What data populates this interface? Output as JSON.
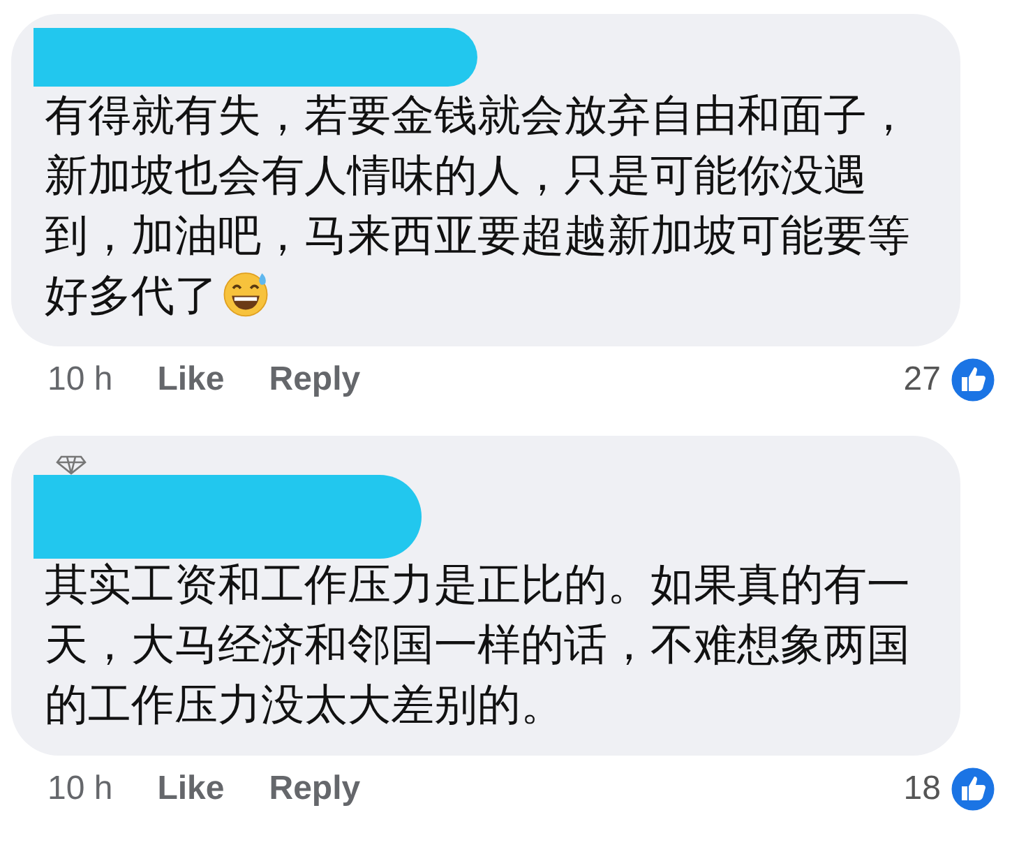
{
  "comments": [
    {
      "redacted_name": true,
      "top_fan_badge": false,
      "text": "有得就有失，若要金钱就会放弃自由和面子，新加坡也会有人情味的人，只是可能你没遇到，加油吧，马来西亚要超越新加坡可能要等好多代了",
      "trailing_emoji": true,
      "time": "10 h",
      "like_label": "Like",
      "reply_label": "Reply",
      "reaction_count": "27"
    },
    {
      "redacted_name": true,
      "top_fan_badge": true,
      "text": "其实工资和工作压力是正比的。如果真的有一天，大马经济和邻国一样的话，不难想象两国的工作压力没太大差别的。",
      "trailing_emoji": false,
      "time": "10 h",
      "like_label": "Like",
      "reply_label": "Reply",
      "reaction_count": "18"
    }
  ]
}
